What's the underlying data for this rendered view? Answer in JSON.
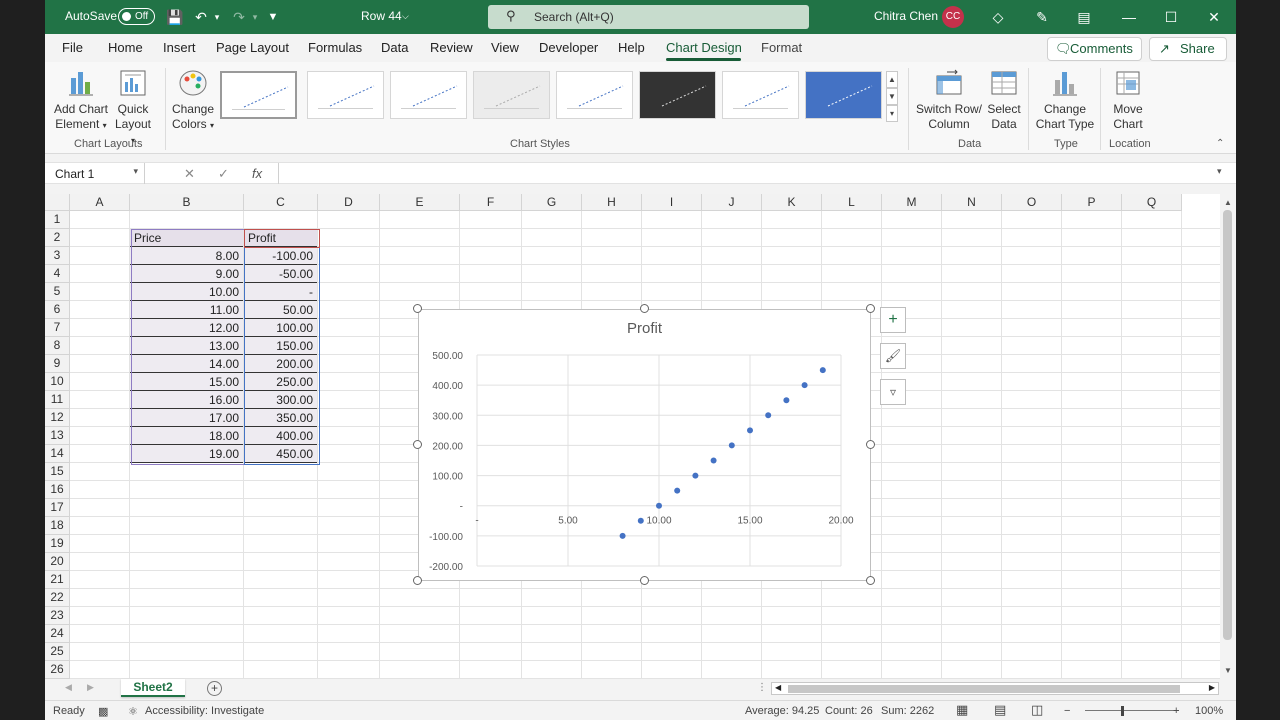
{
  "titlebar": {
    "autosave_label": "AutoSave",
    "autosave_state": "Off",
    "doc_title": "Row 44",
    "search_placeholder": "Search (Alt+Q)",
    "user_name": "Chitra Chen",
    "user_initials": "CC"
  },
  "tabs": [
    "File",
    "Home",
    "Insert",
    "Page Layout",
    "Formulas",
    "Data",
    "Review",
    "View",
    "Developer",
    "Help",
    "Chart Design",
    "Format"
  ],
  "active_tab": "Chart Design",
  "comments_label": "Comments",
  "share_label": "Share",
  "ribbon": {
    "add_chart_element": [
      "Add Chart",
      "Element"
    ],
    "quick_layout": [
      "Quick",
      "Layout"
    ],
    "change_colors": [
      "Change",
      "Colors"
    ],
    "switch_row_column": [
      "Switch Row/",
      "Column"
    ],
    "select_data": [
      "Select",
      "Data"
    ],
    "change_chart_type": [
      "Change",
      "Chart Type"
    ],
    "move_chart": [
      "Move",
      "Chart"
    ],
    "groups": {
      "chart_layouts": "Chart Layouts",
      "chart_styles": "Chart Styles",
      "data": "Data",
      "type": "Type",
      "location": "Location"
    }
  },
  "formula_bar": {
    "name_box": "Chart 1",
    "fx": "fx",
    "cancel": "✕",
    "enter": "✓",
    "value": ""
  },
  "columns": [
    "A",
    "B",
    "C",
    "D",
    "E",
    "F",
    "G",
    "H",
    "I",
    "J",
    "K",
    "L",
    "M",
    "N",
    "O",
    "P",
    "Q"
  ],
  "rows": [
    "1",
    "2",
    "3",
    "4",
    "5",
    "6",
    "7",
    "8",
    "9",
    "10",
    "11",
    "12",
    "13",
    "14",
    "15",
    "16",
    "17",
    "18",
    "19",
    "20",
    "21",
    "22",
    "23",
    "24",
    "25",
    "26"
  ],
  "table": {
    "headers": [
      "Price",
      "Profit"
    ],
    "price": [
      "8.00",
      "9.00",
      "10.00",
      "11.00",
      "12.00",
      "13.00",
      "14.00",
      "15.00",
      "16.00",
      "17.00",
      "18.00",
      "19.00"
    ],
    "profit": [
      "-100.00",
      "-50.00",
      "-",
      "50.00",
      "100.00",
      "150.00",
      "200.00",
      "250.00",
      "300.00",
      "350.00",
      "400.00",
      "450.00"
    ]
  },
  "chart_data": {
    "type": "scatter",
    "title": "Profit",
    "x": [
      8,
      9,
      10,
      11,
      12,
      13,
      14,
      15,
      16,
      17,
      18,
      19
    ],
    "series": [
      {
        "values": [
          -100,
          -50,
          0,
          50,
          100,
          150,
          200,
          250,
          300,
          350,
          400,
          450
        ]
      }
    ],
    "xlim": [
      0,
      20
    ],
    "ylim": [
      -200,
      500
    ],
    "x_ticks": [
      "-",
      "5.00",
      "10.00",
      "15.00",
      "20.00"
    ],
    "x_tick_values": [
      0,
      5,
      10,
      15,
      20
    ],
    "y_ticks": [
      "500.00",
      "400.00",
      "300.00",
      "200.00",
      "100.00",
      "-",
      "-100.00",
      "-200.00"
    ],
    "y_tick_values": [
      500,
      400,
      300,
      200,
      100,
      0,
      -100,
      -200
    ],
    "grid": true,
    "marker_color": "#4472c4"
  },
  "chart_side_buttons": [
    "chart-elements",
    "chart-styles",
    "chart-filters"
  ],
  "sheet": {
    "name": "Sheet2",
    "add": "+"
  },
  "status": {
    "ready": "Ready",
    "accessibility": "Accessibility: Investigate",
    "average": "Average: 94.25",
    "count": "Count: 26",
    "sum": "Sum: 2262",
    "zoom_minus": "−",
    "zoom_plus": "+",
    "zoom": "100%"
  },
  "colors": {
    "brand": "#217346",
    "accent": "#185c37",
    "avatar": "#c4314b"
  }
}
